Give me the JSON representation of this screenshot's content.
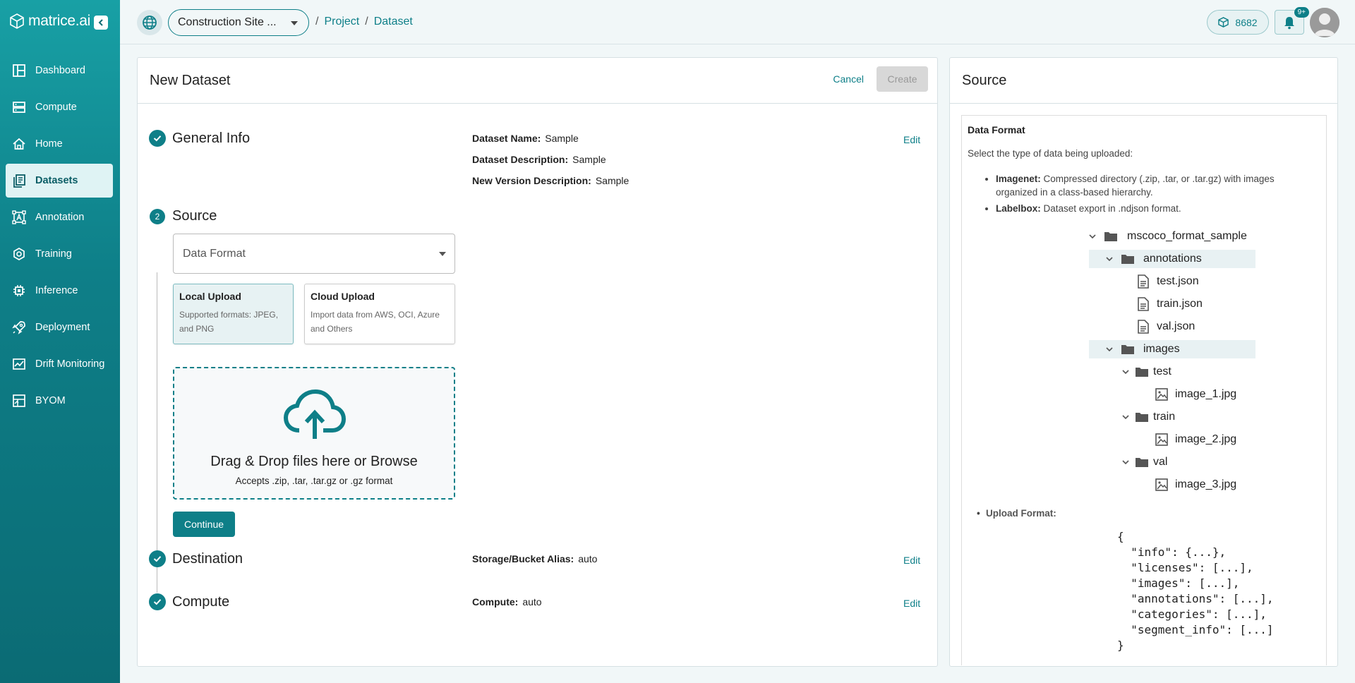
{
  "brand": {
    "name": "matrice.ai"
  },
  "sidebar": {
    "items": [
      {
        "label": "Dashboard",
        "icon": "dashboard-icon"
      },
      {
        "label": "Compute",
        "icon": "server-icon"
      },
      {
        "label": "Home",
        "icon": "home-icon"
      },
      {
        "label": "Datasets",
        "icon": "datasets-icon",
        "active": true
      },
      {
        "label": "Annotation",
        "icon": "annotation-icon"
      },
      {
        "label": "Training",
        "icon": "training-icon"
      },
      {
        "label": "Inference",
        "icon": "inference-icon"
      },
      {
        "label": "Deployment",
        "icon": "rocket-icon"
      },
      {
        "label": "Drift Monitoring",
        "icon": "chart-icon"
      },
      {
        "label": "BYOM",
        "icon": "byom-icon"
      }
    ]
  },
  "topbar": {
    "project_select": "Construction Site ...",
    "breadcrumb": [
      "Project",
      "Dataset"
    ],
    "credits": "8682",
    "notification_badge": "9+"
  },
  "main": {
    "title": "New Dataset",
    "cancel_label": "Cancel",
    "create_label": "Create",
    "steps": {
      "general": {
        "title": "General Info",
        "edit": "Edit",
        "fields": [
          {
            "label": "Dataset Name:",
            "value": "Sample"
          },
          {
            "label": "Dataset Description:",
            "value": "Sample"
          },
          {
            "label": "New Version Description:",
            "value": "Sample"
          }
        ]
      },
      "source": {
        "number": "2",
        "title": "Source"
      },
      "destination": {
        "title": "Destination",
        "edit": "Edit",
        "label": "Storage/Bucket Alias:",
        "value": "auto"
      },
      "compute": {
        "title": "Compute",
        "edit": "Edit",
        "label": "Compute:",
        "value": "auto"
      }
    },
    "data_format_placeholder": "Data Format",
    "upload_options": [
      {
        "title": "Local Upload",
        "desc": "Supported formats: JPEG, and PNG"
      },
      {
        "title": "Cloud Upload",
        "desc": "Import data from AWS, OCI, Azure and Others"
      }
    ],
    "dropzone": {
      "title": "Drag & Drop files here or Browse",
      "subtitle": "Accepts .zip, .tar, .tar.gz or .gz format"
    },
    "continue_label": "Continue"
  },
  "source_panel": {
    "title": "Source",
    "section_title": "Data Format",
    "intro": "Select the type of data being uploaded:",
    "formats": [
      {
        "name": "Imagenet:",
        "desc": "Compressed directory (.zip, .tar, or .tar.gz) with images organized in a class-based hierarchy."
      },
      {
        "name": "Labelbox:",
        "desc": "Dataset export in .ndjson format."
      }
    ],
    "tree": {
      "root": "mscoco_format_sample",
      "annotations": "annotations",
      "files": [
        "test.json",
        "train.json",
        "val.json"
      ],
      "images": "images",
      "test": "test",
      "test_img": "image_1.jpg",
      "train": "train",
      "train_img": "image_2.jpg",
      "val": "val",
      "val_img": "image_3.jpg"
    },
    "upload_format_label": "Upload Format:",
    "code": "{\n  \"info\": {...},\n  \"licenses\": [...],\n  \"images\": [...],\n  \"annotations\": [...],\n  \"categories\": [...],\n  \"segment_info\": [...]\n}"
  }
}
